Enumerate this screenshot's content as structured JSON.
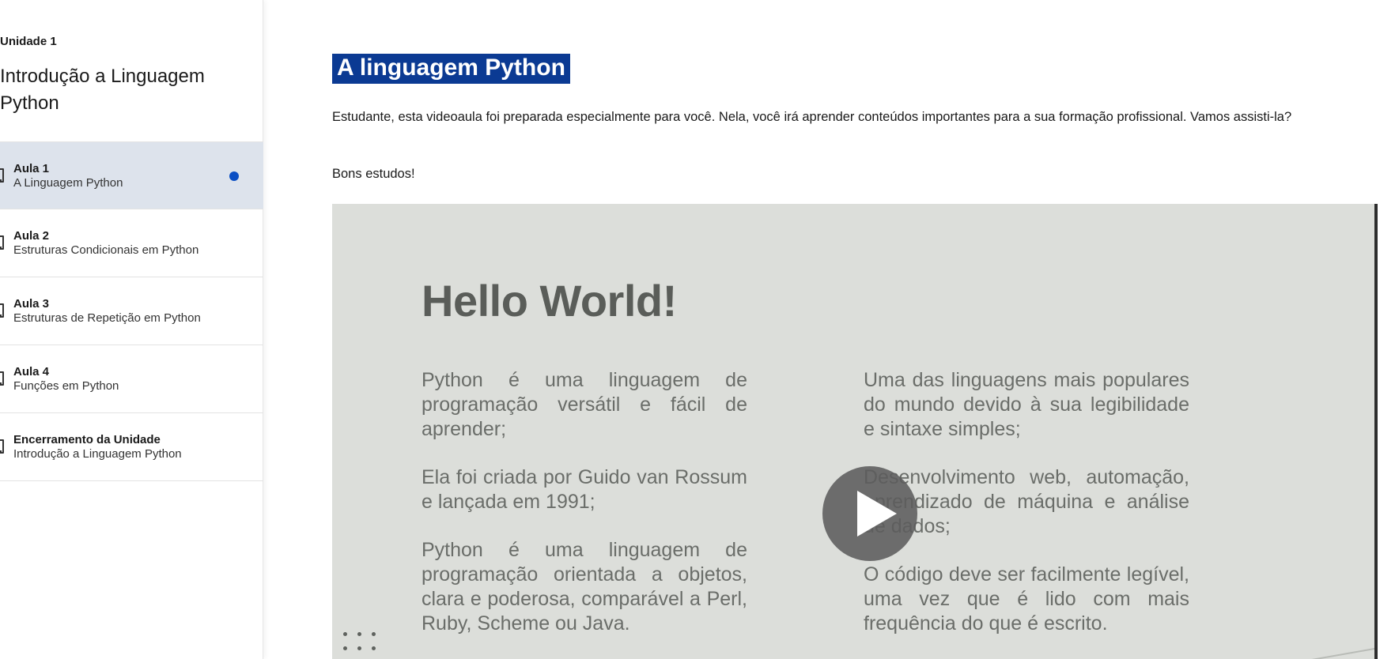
{
  "sidebar": {
    "unit_label": "Unidade 1",
    "unit_title": "Introdução a Linguagem Python",
    "lessons": [
      {
        "title": "Aula 1",
        "subtitle": "A Linguagem Python",
        "active": true
      },
      {
        "title": "Aula 2",
        "subtitle": "Estruturas Condicionais em Python",
        "active": false
      },
      {
        "title": "Aula 3",
        "subtitle": "Estruturas de Repetição em Python",
        "active": false
      },
      {
        "title": "Aula 4",
        "subtitle": "Funções em Python",
        "active": false
      },
      {
        "title": "Encerramento da Unidade",
        "subtitle": "Introdução a Linguagem Python",
        "active": false
      }
    ]
  },
  "main": {
    "heading": "A linguagem Python",
    "intro": "Estudante, esta videoaula foi preparada especialmente para você. Nela, você irá aprender conteúdos importantes para a sua formação profissional. Vamos assisti-la?",
    "closing": "Bons estudos!"
  },
  "video": {
    "slide_title": "Hello World!",
    "left_column": [
      "Python é uma linguagem de programação versátil e fácil de aprender;",
      "Ela foi criada por Guido van Rossum e lançada em 1991;",
      "Python é uma linguagem de programação orientada a objetos, clara e poderosa, comparável a Perl, Ruby, Scheme ou Java."
    ],
    "right_column": [
      "Uma das linguagens mais populares do mundo devido à sua legibilidade e sintaxe simples;",
      "Desenvolvimento web, automação, aprendizado de máquina e análise de dados;",
      "O código deve ser facilmente legível, uma vez que é lido com mais frequência do que é escrito."
    ],
    "play_icon": "play-icon"
  },
  "colors": {
    "accent_blue": "#0b3a93",
    "active_dot": "#0b4fc4",
    "active_row": "#dde3ec"
  }
}
